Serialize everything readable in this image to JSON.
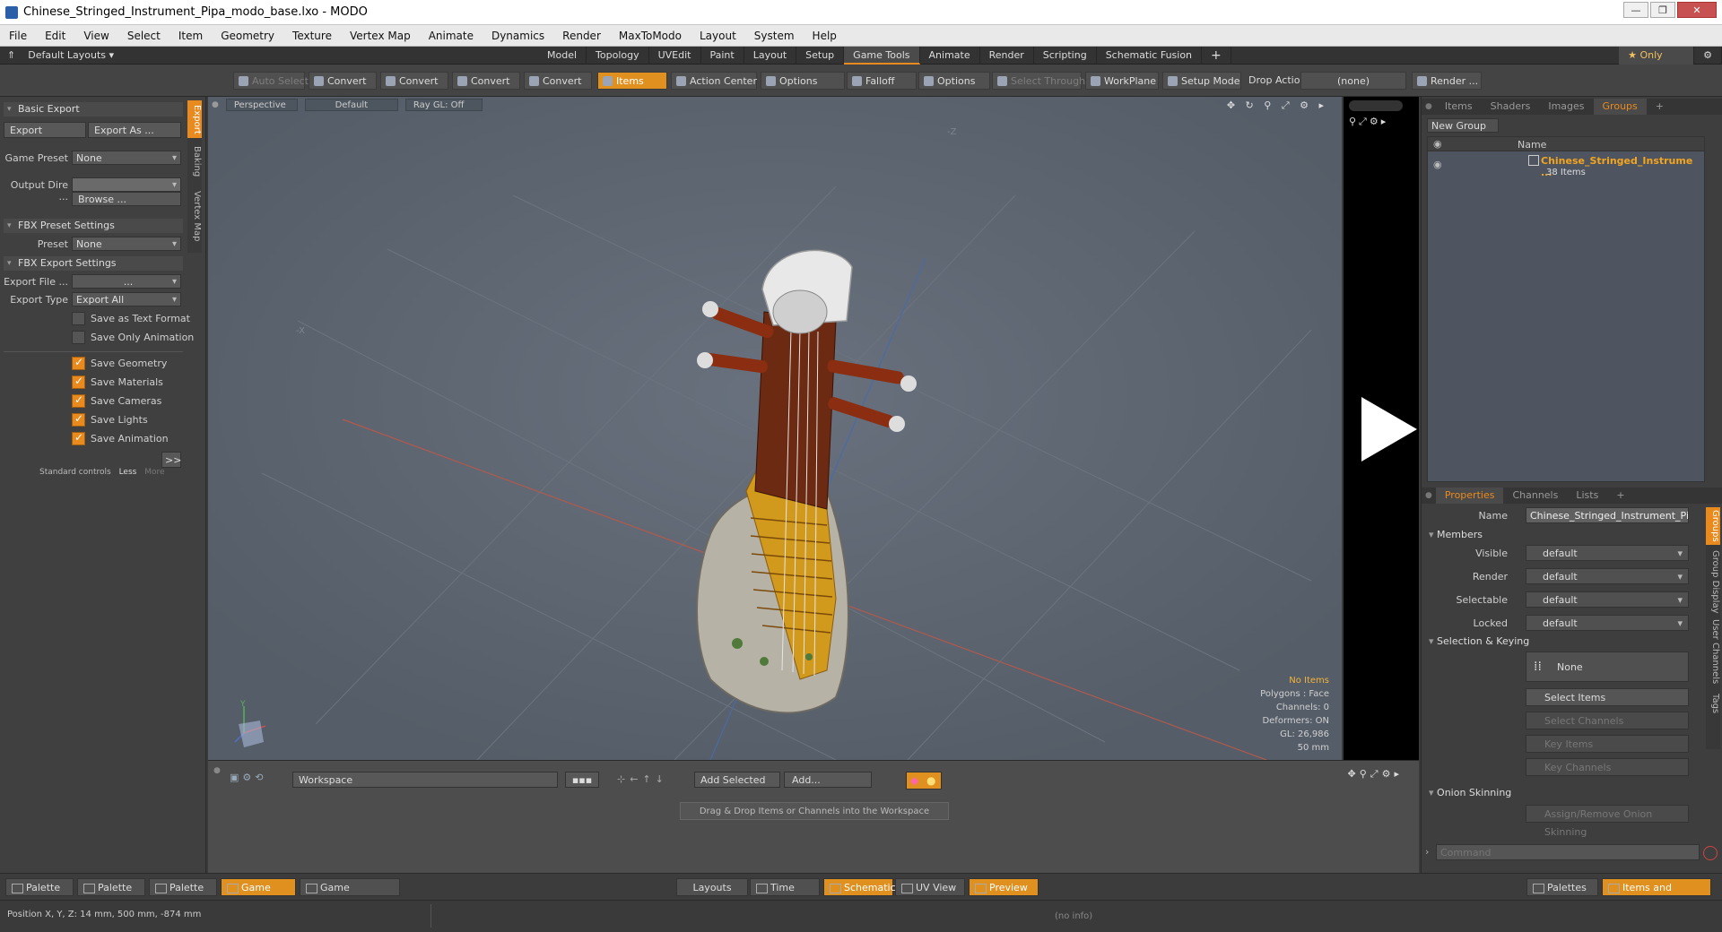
{
  "window": {
    "title": "Chinese_Stringed_Instrument_Pipa_modo_base.lxo - MODO",
    "min": "—",
    "max": "❐",
    "close": "✕"
  },
  "menu": [
    "File",
    "Edit",
    "View",
    "Select",
    "Item",
    "Geometry",
    "Texture",
    "Vertex Map",
    "Animate",
    "Dynamics",
    "Render",
    "MaxToModo",
    "Layout",
    "System",
    "Help"
  ],
  "layouts": {
    "default": "Default Layouts ▾",
    "tabs": [
      "Model",
      "Topology",
      "UVEdit",
      "Paint",
      "Layout",
      "Setup",
      "Game Tools",
      "Animate",
      "Render",
      "Scripting",
      "Schematic Fusion"
    ],
    "active": "Game Tools",
    "add": "+",
    "only": "★  Only",
    "gear": "⚙"
  },
  "toolbar": {
    "auto_select": "Auto Select",
    "convert1": "Convert",
    "convert2": "Convert",
    "convert3": "Convert",
    "convert4": "Convert",
    "items": "Items",
    "action_center": "Action Center",
    "options1": "Options",
    "falloff": "Falloff",
    "options2": "Options",
    "select_through": "Select Through",
    "workplane": "WorkPlane",
    "setup_mode": "Setup Mode",
    "drop_action": "Drop Action",
    "drop_value": "(none)",
    "render": "Render ..."
  },
  "left": {
    "basic_export": "Basic Export",
    "export": "Export",
    "export_as": "Export As ...",
    "game_preset_label": "Game Preset",
    "game_preset_value": "None",
    "output_dir_label": "Output Dire ...",
    "browse": "Browse ...",
    "fbx_preset": "FBX Preset Settings",
    "preset_label": "Preset",
    "preset_value": "None",
    "fbx_export": "FBX Export Settings",
    "export_file_label": "Export File ...",
    "export_file_value": "...",
    "export_type_label": "Export Type",
    "export_type_value": "Export All",
    "save_text": "Save as Text Format",
    "save_anim_only": "Save Only Animation",
    "save_geometry": "Save Geometry",
    "save_materials": "Save Materials",
    "save_cameras": "Save Cameras",
    "save_lights": "Save Lights",
    "save_animation": "Save Animation",
    "more_btn": ">>",
    "std_controls": "Standard controls",
    "less": "Less",
    "more": "More",
    "vtabs": [
      "Export",
      "Baking",
      "Vertex Map"
    ]
  },
  "viewport": {
    "perspective": "Perspective",
    "default": "Default",
    "raygl": "Ray GL: Off",
    "icons": "✥ ↻ ⚲ ⤢ ⚙ ▸",
    "axis_z": "-Z",
    "axis_x": "-X",
    "no_items": "No Items",
    "polygons": "Polygons : Face",
    "channels": "Channels: 0",
    "deformers": "Deformers: ON",
    "gl": "GL: 26,986",
    "mm": "50 mm",
    "gizmo_y": "Y"
  },
  "items_panel": {
    "tabs": [
      "Items",
      "Shaders",
      "Images",
      "Groups"
    ],
    "active": "Groups",
    "new_group": "New Group",
    "col_name": "Name",
    "group_name": "Chinese_Stringed_Instrume ...",
    "group_count": "38 Items"
  },
  "properties": {
    "tabs": [
      "Properties",
      "Channels",
      "Lists"
    ],
    "active": "Properties",
    "name_label": "Name",
    "name_value": "Chinese_Stringed_Instrument_Pipa",
    "members": "Members",
    "visible_label": "Visible",
    "render_label": "Render",
    "selectable_label": "Selectable",
    "locked_label": "Locked",
    "default_value": "default",
    "sel_keying": "Selection & Keying",
    "none": "None",
    "select_items": "Select Items",
    "select_channels": "Select Channels",
    "key_items": "Key Items",
    "key_channels": "Key Channels",
    "onion": "Onion Skinning",
    "assign_onion": "Assign/Remove Onion Skinning",
    "command_placeholder": "Command",
    "vtabs": [
      "Groups",
      "Group Display",
      "User Channels",
      "Tags"
    ]
  },
  "schematic": {
    "workspace": "Workspace",
    "add_selected": "Add Selected",
    "add": "Add...",
    "hint": "Drag & Drop Items or Channels into the Workspace"
  },
  "bottom": {
    "palette": "Palette",
    "game_tools": "Game Tools",
    "game_navigation": "Game Navigation",
    "layouts": "Layouts",
    "time": "Time",
    "schematic": "Schematic",
    "uv_view": "UV View",
    "preview": "Preview",
    "palettes": "Palettes",
    "items_shading": "Items and Shading"
  },
  "status": {
    "position": "Position X, Y, Z:   14 mm, 500 mm, -874 mm",
    "info": "(no info)"
  },
  "colors": {
    "accent": "#e98a1e",
    "viewport": "#5b6470",
    "panel": "#404040"
  }
}
